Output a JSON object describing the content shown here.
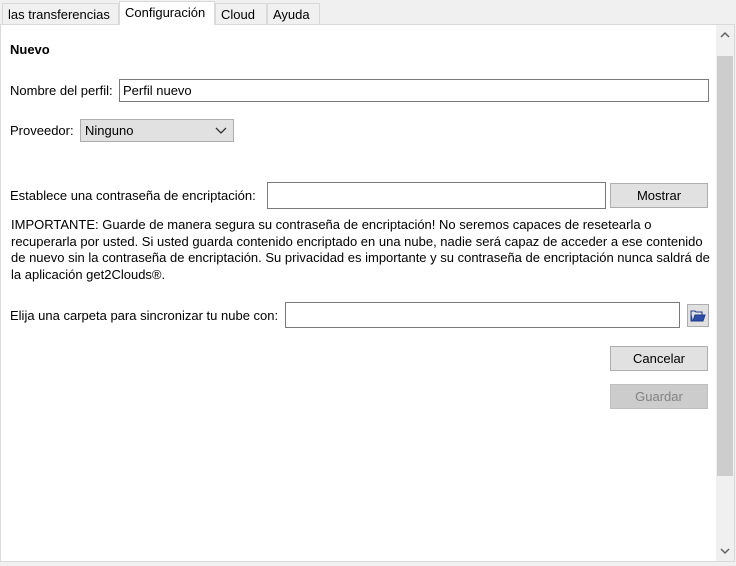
{
  "tabs": [
    {
      "label": "las transferencias",
      "active": false
    },
    {
      "label": "Configuración",
      "active": true
    },
    {
      "label": "Cloud",
      "active": false
    },
    {
      "label": "Ayuda",
      "active": false
    }
  ],
  "form": {
    "heading": "Nuevo",
    "profile_name_label": "Nombre del perfil:",
    "profile_name_value": "Perfil nuevo",
    "provider_label": "Proveedor:",
    "provider_value": "Ninguno",
    "password_label": "Establece una contraseña de encriptación:",
    "password_value": "",
    "show_button": "Mostrar",
    "important_text": "IMPORTANTE: Guarde de manera segura su contraseña de encriptación! No seremos capaces de resetearla o recuperarla por usted. Si usted guarda contenido encriptado en una nube, nadie será capaz de acceder a ese contenido de nuevo sin la contraseña de encriptación. Su privacidad es importante y su contraseña de encriptación nunca saldrá de la aplicación get2Clouds®.",
    "folder_label": "Elija una carpeta para sincronizar tu nube con:",
    "folder_value": "",
    "folder_icon": "folder-icon",
    "cancel_button": "Cancelar",
    "save_button": "Guardar",
    "save_enabled": false
  },
  "colors": {
    "folder_icon": "#1f3a8a",
    "disabled_text": "#838383"
  }
}
